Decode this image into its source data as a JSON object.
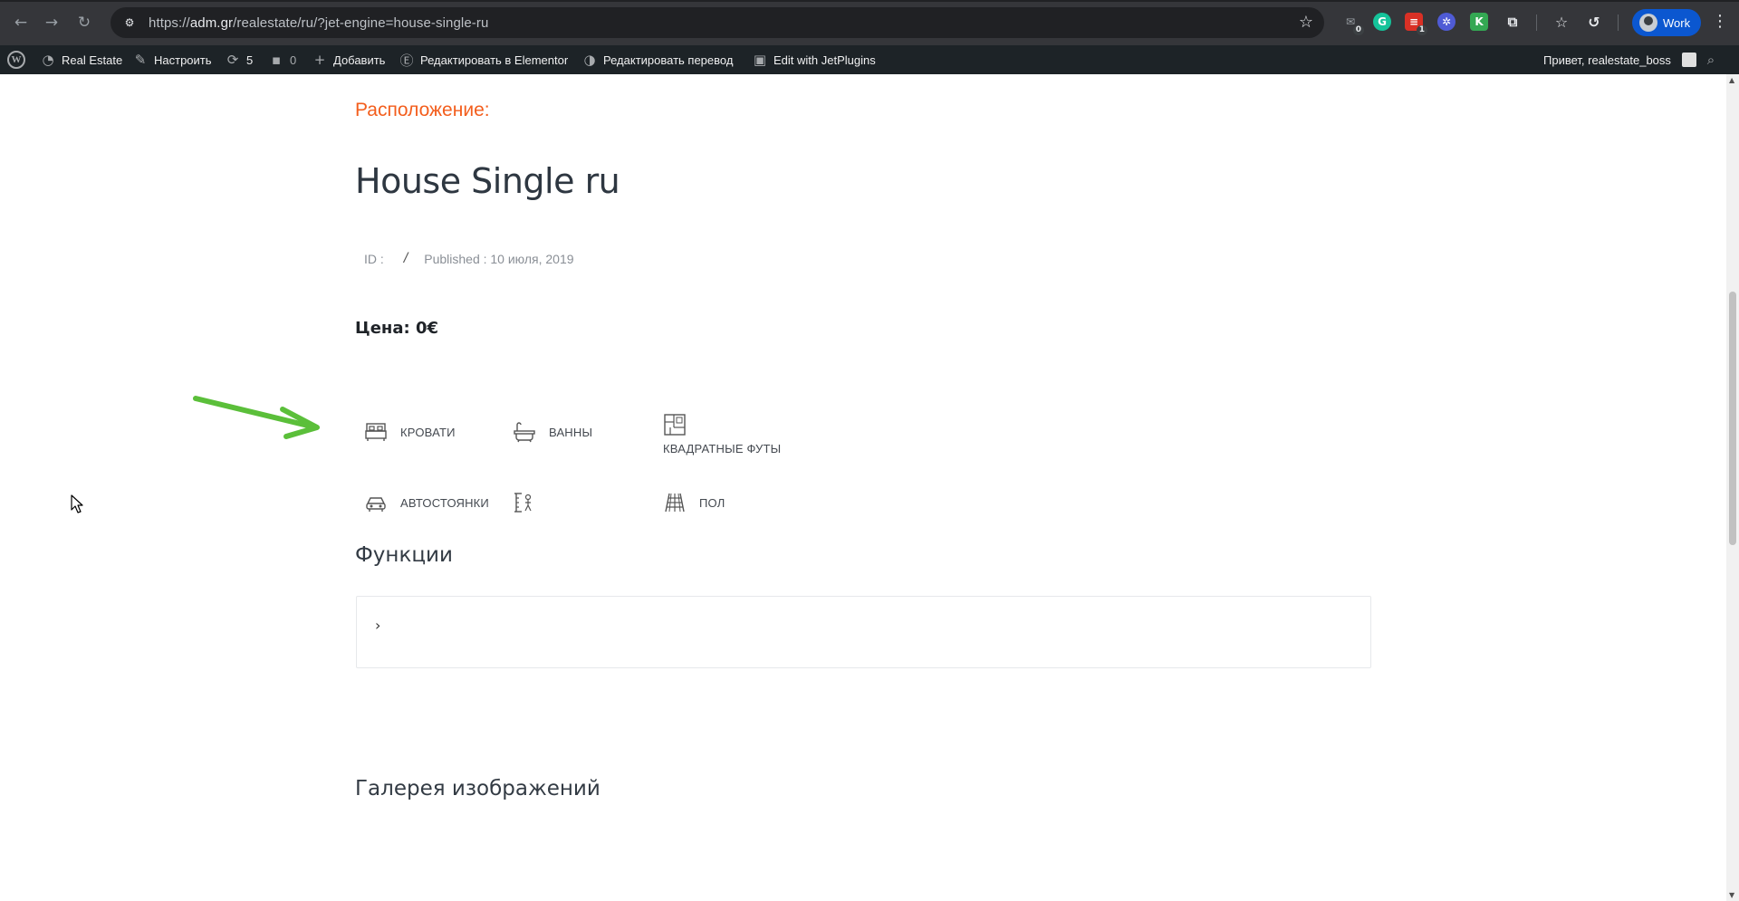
{
  "browser": {
    "url_host": "adm.gr",
    "url_prefix": "https://",
    "url_path": "/realestate/ru/?jet-engine=house-single-ru",
    "profile_label": "Work",
    "extensions": [
      {
        "name": "mail-extension-icon",
        "badge": "0",
        "color": "#5f6368"
      },
      {
        "name": "grammarly-icon",
        "badge": "",
        "color": "#15c39a"
      },
      {
        "name": "red-extension-icon",
        "badge": "1",
        "color": "#d93025"
      },
      {
        "name": "blue-extension-icon",
        "badge": "",
        "color": "#4f5bd5"
      },
      {
        "name": "green-k-extension-icon",
        "badge": "",
        "color": "#34a853"
      }
    ]
  },
  "adminbar": {
    "site_name": "Real Estate",
    "customize": "Настроить",
    "updates_count": "5",
    "comments_count": "0",
    "add_new": "Добавить",
    "edit_elementor": "Редактировать в Elementor",
    "edit_translation": "Редактировать перевод",
    "edit_jetplugins": "Edit with JetPlugins",
    "greeting": "Привет, realestate_boss"
  },
  "listing": {
    "location_label": "Расположение:",
    "title": "House Single ru",
    "id_label": "ID :",
    "published": "Published : 10 июля, 2019",
    "price": "Цена: 0€"
  },
  "properties": {
    "beds": "КРОВАТИ",
    "baths": "ВАННЫ",
    "sqft": "КВАДРАТНЫЕ ФУТЫ",
    "parking": "АВТОСТОЯНКИ",
    "floor": "ПОЛ"
  },
  "sections": {
    "features": "Функции",
    "gallery": "Галерея изображений"
  },
  "colors": {
    "accent": "#f35e1d",
    "annotation_arrow": "#5bbf3a",
    "adminbar_bg": "#1d2327"
  }
}
